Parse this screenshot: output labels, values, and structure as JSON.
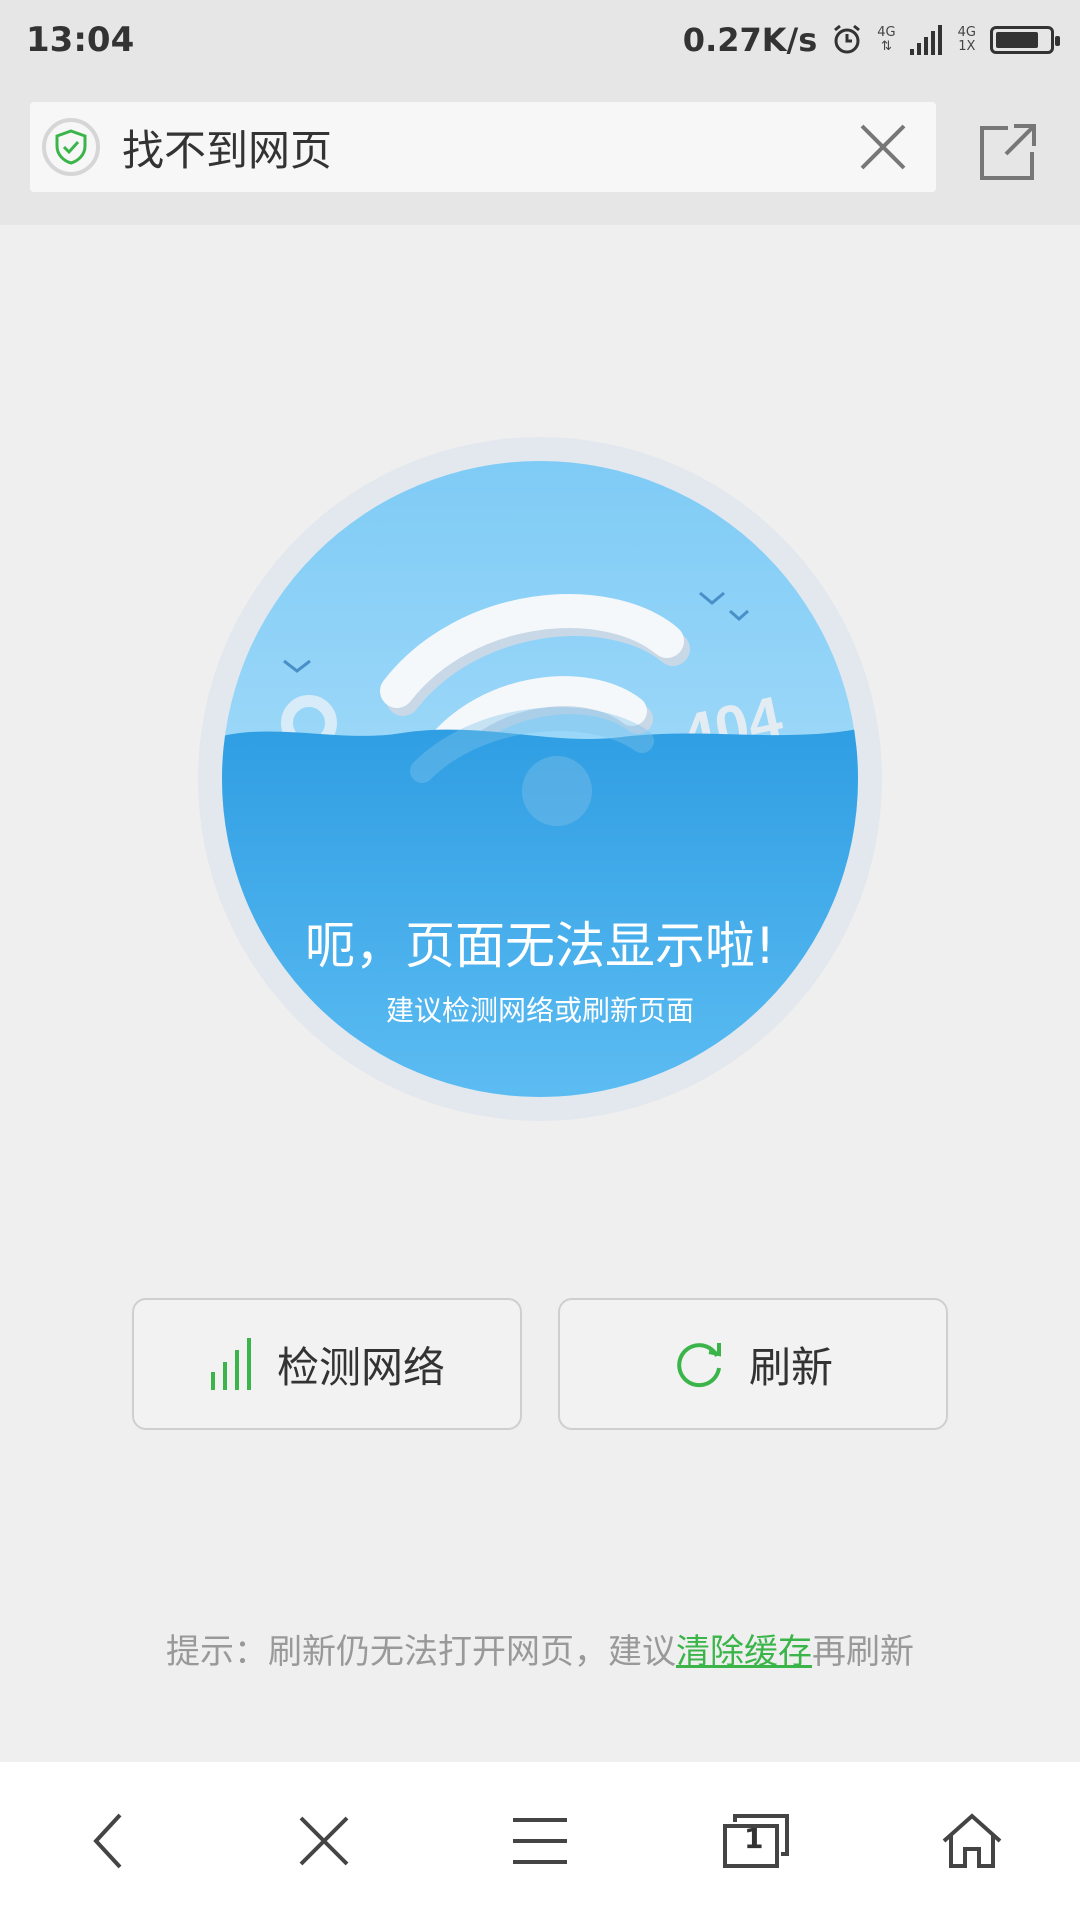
{
  "status_bar": {
    "time": "13:04",
    "speed": "0.27K/s",
    "net_top": "4G",
    "net_bottom": "1X"
  },
  "address_bar": {
    "title": "找不到网页",
    "shield_icon": "security-shield-icon",
    "close_icon": "close-icon",
    "share_icon": "share-external-icon"
  },
  "error": {
    "title": "呃，页面无法显示啦!",
    "subtitle": "建议检测网络或刷新页面",
    "badge": "404"
  },
  "buttons": {
    "check_network": "检测网络",
    "refresh": "刷新"
  },
  "hint": {
    "prefix": "提示：刷新仍无法打开网页，建议",
    "link": "清除缓存",
    "suffix": "再刷新"
  },
  "bottom_nav": {
    "tab_count": "1",
    "icons": [
      "back-icon",
      "close-icon",
      "menu-icon",
      "tabs-icon",
      "home-icon"
    ]
  },
  "colors": {
    "accent_green": "#3bb54a",
    "sky_blue": "#8fd0f7",
    "water_blue": "#35a3e6"
  }
}
